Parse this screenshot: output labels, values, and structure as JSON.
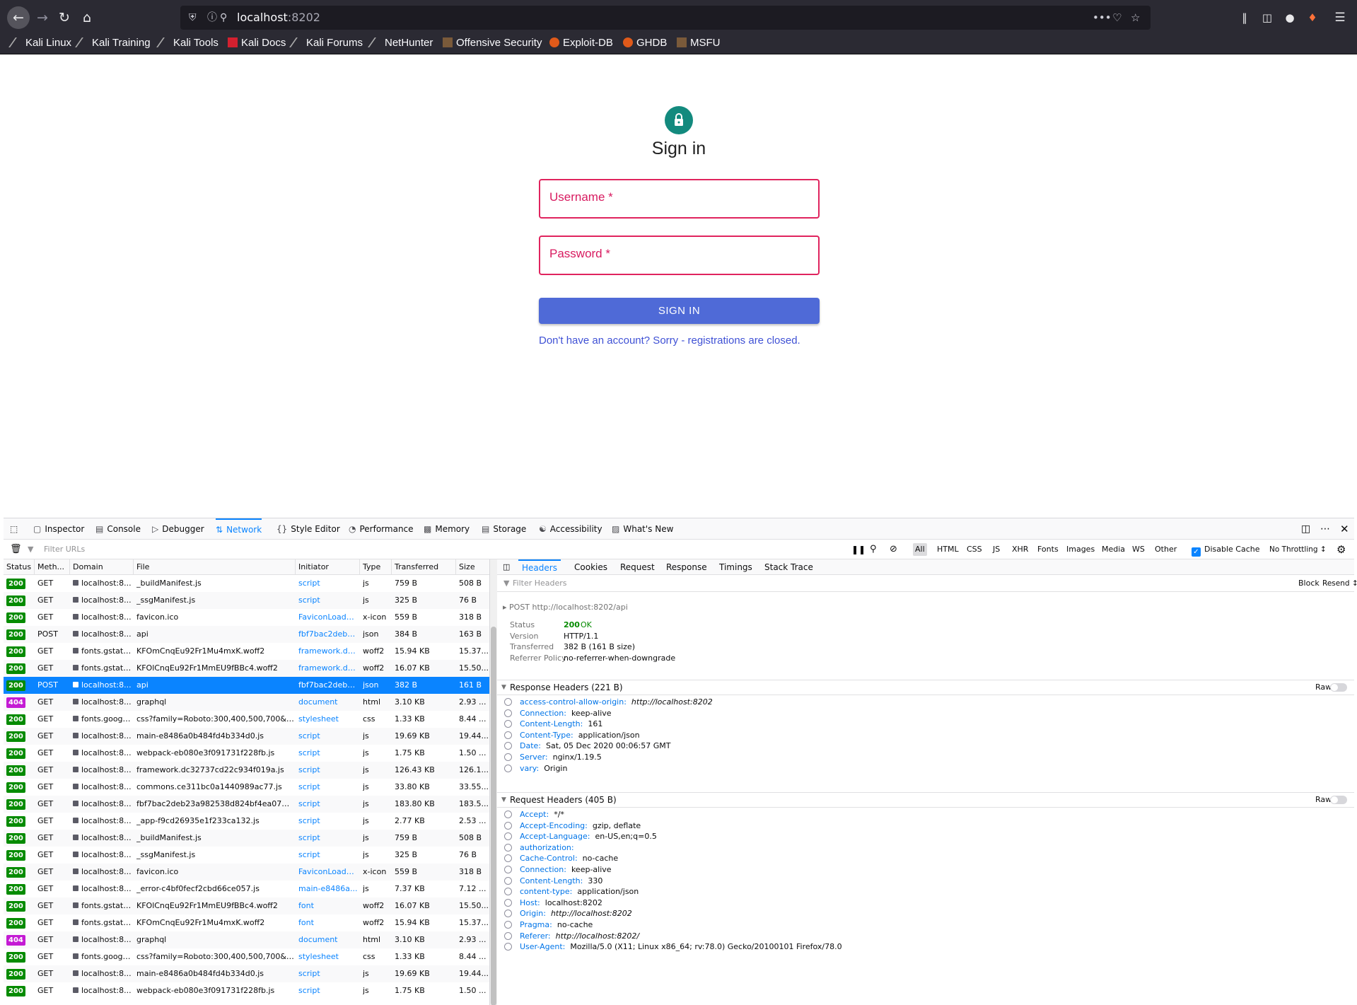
{
  "browser": {
    "url_domain": "localhost",
    "url_port": ":8202",
    "bookmarks": [
      "Kali Linux",
      "Kali Training",
      "Kali Tools",
      "Kali Docs",
      "Kali Forums",
      "NetHunter",
      "Offensive Security",
      "Exploit-DB",
      "GHDB",
      "MSFU"
    ]
  },
  "page": {
    "title": "Sign in",
    "username_label": "Username *",
    "password_label": "Password *",
    "signin_button": "SIGN IN",
    "register_text": "Don't have an account? Sorry - registrations are closed."
  },
  "devtools": {
    "tabs": [
      "Inspector",
      "Console",
      "Debugger",
      "Network",
      "Style Editor",
      "Performance",
      "Memory",
      "Storage",
      "Accessibility",
      "What's New"
    ],
    "selected_tab": "Network",
    "filter_placeholder": "Filter URLs",
    "type_filters": [
      "All",
      "HTML",
      "CSS",
      "JS",
      "XHR",
      "Fonts",
      "Images",
      "Media",
      "WS",
      "Other"
    ],
    "disable_cache": "Disable Cache",
    "throttling": "No Throttling ↕",
    "columns": [
      "Status",
      "Meth...",
      "Domain",
      "File",
      "Initiator",
      "Type",
      "Transferred",
      "Size"
    ],
    "requests": [
      {
        "status": "200",
        "method": "GET",
        "domain": "localhost:8...",
        "file": "_buildManifest.js",
        "initiator": "script",
        "type": "js",
        "transferred": "759 B",
        "size": "508 B"
      },
      {
        "status": "200",
        "method": "GET",
        "domain": "localhost:8...",
        "file": "_ssgManifest.js",
        "initiator": "script",
        "type": "js",
        "transferred": "325 B",
        "size": "76 B"
      },
      {
        "status": "200",
        "method": "GET",
        "domain": "localhost:8...",
        "file": "favicon.ico",
        "initiator": "FaviconLoader...",
        "type": "x-icon",
        "transferred": "559 B",
        "size": "318 B"
      },
      {
        "status": "200",
        "method": "POST",
        "domain": "localhost:8...",
        "file": "api",
        "initiator": "fbf7bac2deb23...",
        "type": "json",
        "transferred": "384 B",
        "size": "163 B"
      },
      {
        "status": "200",
        "method": "GET",
        "domain": "fonts.gstati...",
        "file": "KFOmCnqEu92Fr1Mu4mxK.woff2",
        "initiator": "framework.dc...",
        "type": "woff2",
        "transferred": "15.94 KB",
        "size": "15.37..."
      },
      {
        "status": "200",
        "method": "GET",
        "domain": "fonts.gstati...",
        "file": "KFOlCnqEu92Fr1MmEU9fBBc4.woff2",
        "initiator": "framework.dc...",
        "type": "woff2",
        "transferred": "16.07 KB",
        "size": "15.50..."
      },
      {
        "status": "200",
        "method": "POST",
        "domain": "localhost:8...",
        "file": "api",
        "initiator": "fbf7bac2deb23...",
        "type": "json",
        "transferred": "382 B",
        "size": "161 B",
        "selected": true
      },
      {
        "status": "404",
        "method": "GET",
        "domain": "localhost:8...",
        "file": "graphql",
        "initiator": "document",
        "type": "html",
        "transferred": "3.10 KB",
        "size": "2.93 ..."
      },
      {
        "status": "200",
        "method": "GET",
        "domain": "fonts.googl...",
        "file": "css?family=Roboto:300,400,500,700&dis...",
        "initiator": "stylesheet",
        "type": "css",
        "transferred": "1.33 KB",
        "size": "8.44 ..."
      },
      {
        "status": "200",
        "method": "GET",
        "domain": "localhost:8...",
        "file": "main-e8486a0b484fd4b334d0.js",
        "initiator": "script",
        "type": "js",
        "transferred": "19.69 KB",
        "size": "19.44..."
      },
      {
        "status": "200",
        "method": "GET",
        "domain": "localhost:8...",
        "file": "webpack-eb080e3f091731f228fb.js",
        "initiator": "script",
        "type": "js",
        "transferred": "1.75 KB",
        "size": "1.50 ..."
      },
      {
        "status": "200",
        "method": "GET",
        "domain": "localhost:8...",
        "file": "framework.dc32737cd22c934f019a.js",
        "initiator": "script",
        "type": "js",
        "transferred": "126.43 KB",
        "size": "126.1..."
      },
      {
        "status": "200",
        "method": "GET",
        "domain": "localhost:8...",
        "file": "commons.ce311bc0a1440989ac77.js",
        "initiator": "script",
        "type": "js",
        "transferred": "33.80 KB",
        "size": "33.55..."
      },
      {
        "status": "200",
        "method": "GET",
        "domain": "localhost:8...",
        "file": "fbf7bac2deb23a982538d824bf4ea07943c...",
        "initiator": "script",
        "type": "js",
        "transferred": "183.80 KB",
        "size": "183.5..."
      },
      {
        "status": "200",
        "method": "GET",
        "domain": "localhost:8...",
        "file": "_app-f9cd26935e1f233ca132.js",
        "initiator": "script",
        "type": "js",
        "transferred": "2.77 KB",
        "size": "2.53 ..."
      },
      {
        "status": "200",
        "method": "GET",
        "domain": "localhost:8...",
        "file": "_buildManifest.js",
        "initiator": "script",
        "type": "js",
        "transferred": "759 B",
        "size": "508 B"
      },
      {
        "status": "200",
        "method": "GET",
        "domain": "localhost:8...",
        "file": "_ssgManifest.js",
        "initiator": "script",
        "type": "js",
        "transferred": "325 B",
        "size": "76 B"
      },
      {
        "status": "200",
        "method": "GET",
        "domain": "localhost:8...",
        "file": "favicon.ico",
        "initiator": "FaviconLoader...",
        "type": "x-icon",
        "transferred": "559 B",
        "size": "318 B"
      },
      {
        "status": "200",
        "method": "GET",
        "domain": "localhost:8...",
        "file": "_error-c4bf0fecf2cbd66ce057.js",
        "initiator": "main-e8486a...",
        "type": "js",
        "transferred": "7.37 KB",
        "size": "7.12 ..."
      },
      {
        "status": "200",
        "method": "GET",
        "domain": "fonts.gstati...",
        "file": "KFOlCnqEu92Fr1MmEU9fBBc4.woff2",
        "initiator": "font",
        "type": "woff2",
        "transferred": "16.07 KB",
        "size": "15.50..."
      },
      {
        "status": "200",
        "method": "GET",
        "domain": "fonts.gstati...",
        "file": "KFOmCnqEu92Fr1Mu4mxK.woff2",
        "initiator": "font",
        "type": "woff2",
        "transferred": "15.94 KB",
        "size": "15.37..."
      },
      {
        "status": "404",
        "method": "GET",
        "domain": "localhost:8...",
        "file": "graphql",
        "initiator": "document",
        "type": "html",
        "transferred": "3.10 KB",
        "size": "2.93 ..."
      },
      {
        "status": "200",
        "method": "GET",
        "domain": "fonts.googl...",
        "file": "css?family=Roboto:300,400,500,700&dis...",
        "initiator": "stylesheet",
        "type": "css",
        "transferred": "1.33 KB",
        "size": "8.44 ..."
      },
      {
        "status": "200",
        "method": "GET",
        "domain": "localhost:8...",
        "file": "main-e8486a0b484fd4b334d0.js",
        "initiator": "script",
        "type": "js",
        "transferred": "19.69 KB",
        "size": "19.44..."
      },
      {
        "status": "200",
        "method": "GET",
        "domain": "localhost:8...",
        "file": "webpack-eb080e3f091731f228fb.js",
        "initiator": "script",
        "type": "js",
        "transferred": "1.75 KB",
        "size": "1.50 ..."
      }
    ],
    "details": {
      "tabs": [
        "Headers",
        "Cookies",
        "Request",
        "Response",
        "Timings",
        "Stack Trace"
      ],
      "filter_placeholder": "Filter Headers",
      "block": "Block",
      "resend": "Resend ↕",
      "request_line": "POST",
      "request_url": "http://localhost:8202/api",
      "summary": [
        {
          "label": "Status",
          "value": "200",
          "extra": "OK"
        },
        {
          "label": "Version",
          "value": "HTTP/1.1"
        },
        {
          "label": "Transferred",
          "value": "382 B (161 B size)"
        },
        {
          "label": "Referrer Policy",
          "value": "no-referrer-when-downgrade"
        }
      ],
      "response_title": "Response Headers (221 B)",
      "raw": "Raw",
      "response_headers": [
        {
          "k": "access-control-allow-origin:",
          "v": "http://localhost:8202",
          "it": true
        },
        {
          "k": "Connection:",
          "v": "keep-alive"
        },
        {
          "k": "Content-Length:",
          "v": "161"
        },
        {
          "k": "Content-Type:",
          "v": "application/json"
        },
        {
          "k": "Date:",
          "v": "Sat, 05 Dec 2020 00:06:57 GMT"
        },
        {
          "k": "Server:",
          "v": "nginx/1.19.5"
        },
        {
          "k": "vary:",
          "v": "Origin"
        }
      ],
      "request_title": "Request Headers (405 B)",
      "request_headers": [
        {
          "k": "Accept:",
          "v": "*/*"
        },
        {
          "k": "Accept-Encoding:",
          "v": "gzip, deflate"
        },
        {
          "k": "Accept-Language:",
          "v": "en-US,en;q=0.5"
        },
        {
          "k": "authorization:",
          "v": ""
        },
        {
          "k": "Cache-Control:",
          "v": "no-cache"
        },
        {
          "k": "Connection:",
          "v": "keep-alive"
        },
        {
          "k": "Content-Length:",
          "v": "330"
        },
        {
          "k": "content-type:",
          "v": "application/json"
        },
        {
          "k": "Host:",
          "v": "localhost:8202"
        },
        {
          "k": "Origin:",
          "v": "http://localhost:8202",
          "it": true
        },
        {
          "k": "Pragma:",
          "v": "no-cache"
        },
        {
          "k": "Referer:",
          "v": "http://localhost:8202/",
          "it": true
        },
        {
          "k": "User-Agent:",
          "v": "Mozilla/5.0 (X11; Linux x86_64; rv:78.0) Gecko/20100101 Firefox/78.0"
        }
      ]
    }
  },
  "colors": {
    "status_ok": "#058b00",
    "status_404": "#c41bd4",
    "accent": "#0a84ff",
    "signin": "#4f6ad7",
    "error": "#e0245e"
  }
}
